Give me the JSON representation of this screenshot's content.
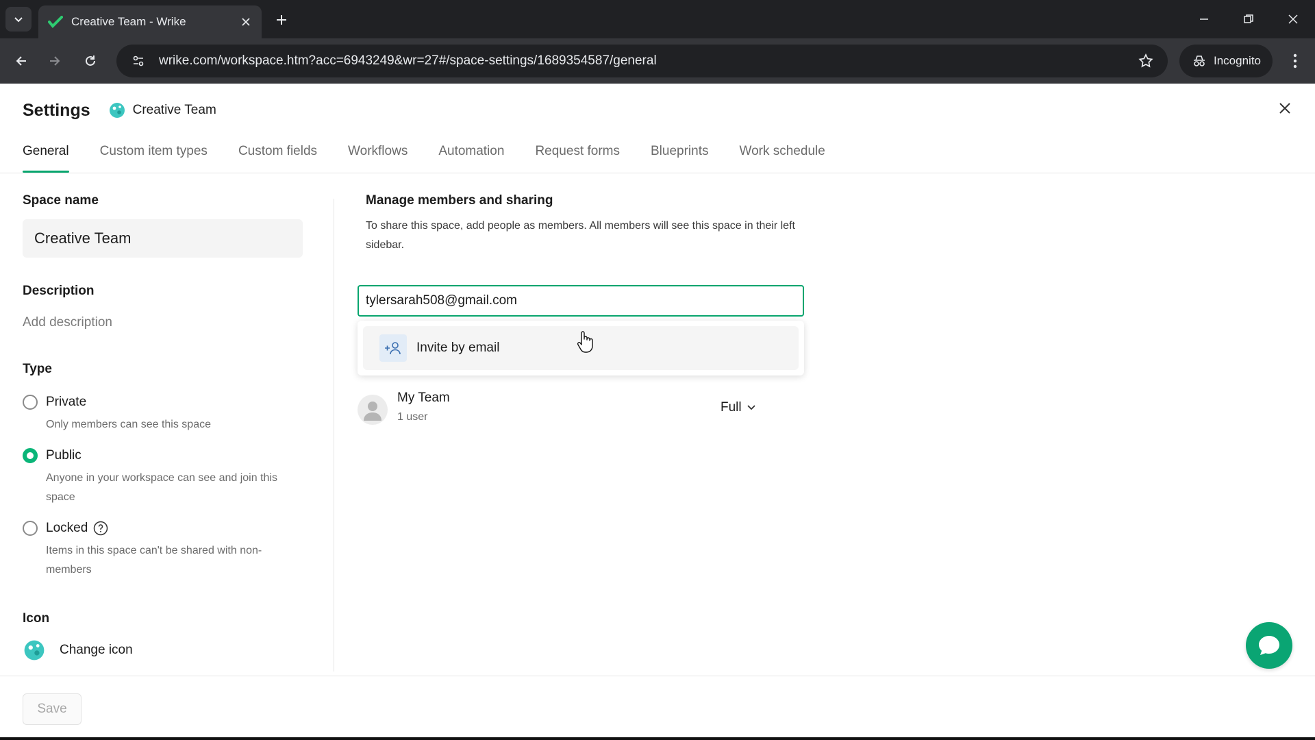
{
  "browser": {
    "tab_title": "Creative Team - Wrike",
    "url": "wrike.com/workspace.htm?acc=6943249&wr=27#/space-settings/1689354587/general",
    "incognito_label": "Incognito"
  },
  "settings": {
    "title": "Settings",
    "space_name": "Creative Team",
    "tabs": [
      {
        "label": "General",
        "active": true
      },
      {
        "label": "Custom item types"
      },
      {
        "label": "Custom fields"
      },
      {
        "label": "Workflows"
      },
      {
        "label": "Automation"
      },
      {
        "label": "Request forms"
      },
      {
        "label": "Blueprints"
      },
      {
        "label": "Work schedule"
      }
    ]
  },
  "left": {
    "space_name_label": "Space name",
    "space_name_value": "Creative Team",
    "description_label": "Description",
    "description_placeholder": "Add description",
    "type_label": "Type",
    "types": [
      {
        "label": "Private",
        "desc": "Only members can see this space",
        "selected": false
      },
      {
        "label": "Public",
        "desc": "Anyone in your workspace can see and join this space",
        "selected": true
      },
      {
        "label": "Locked",
        "desc": "Items in this space can't be shared with non-members",
        "selected": false
      }
    ],
    "icon_label": "Icon",
    "change_icon_label": "Change icon"
  },
  "right": {
    "title": "Manage members and sharing",
    "description": "To share this space, add people as members. All members will see this space in their left sidebar.",
    "email_value": "tylersarah508@gmail.com",
    "invite_label": "Invite by email",
    "member": {
      "name": "My Team",
      "sub": "1 user",
      "access": "Full"
    }
  },
  "footer": {
    "save_label": "Save"
  },
  "colors": {
    "accent": "#08a56e",
    "chat": "#0aa573"
  }
}
